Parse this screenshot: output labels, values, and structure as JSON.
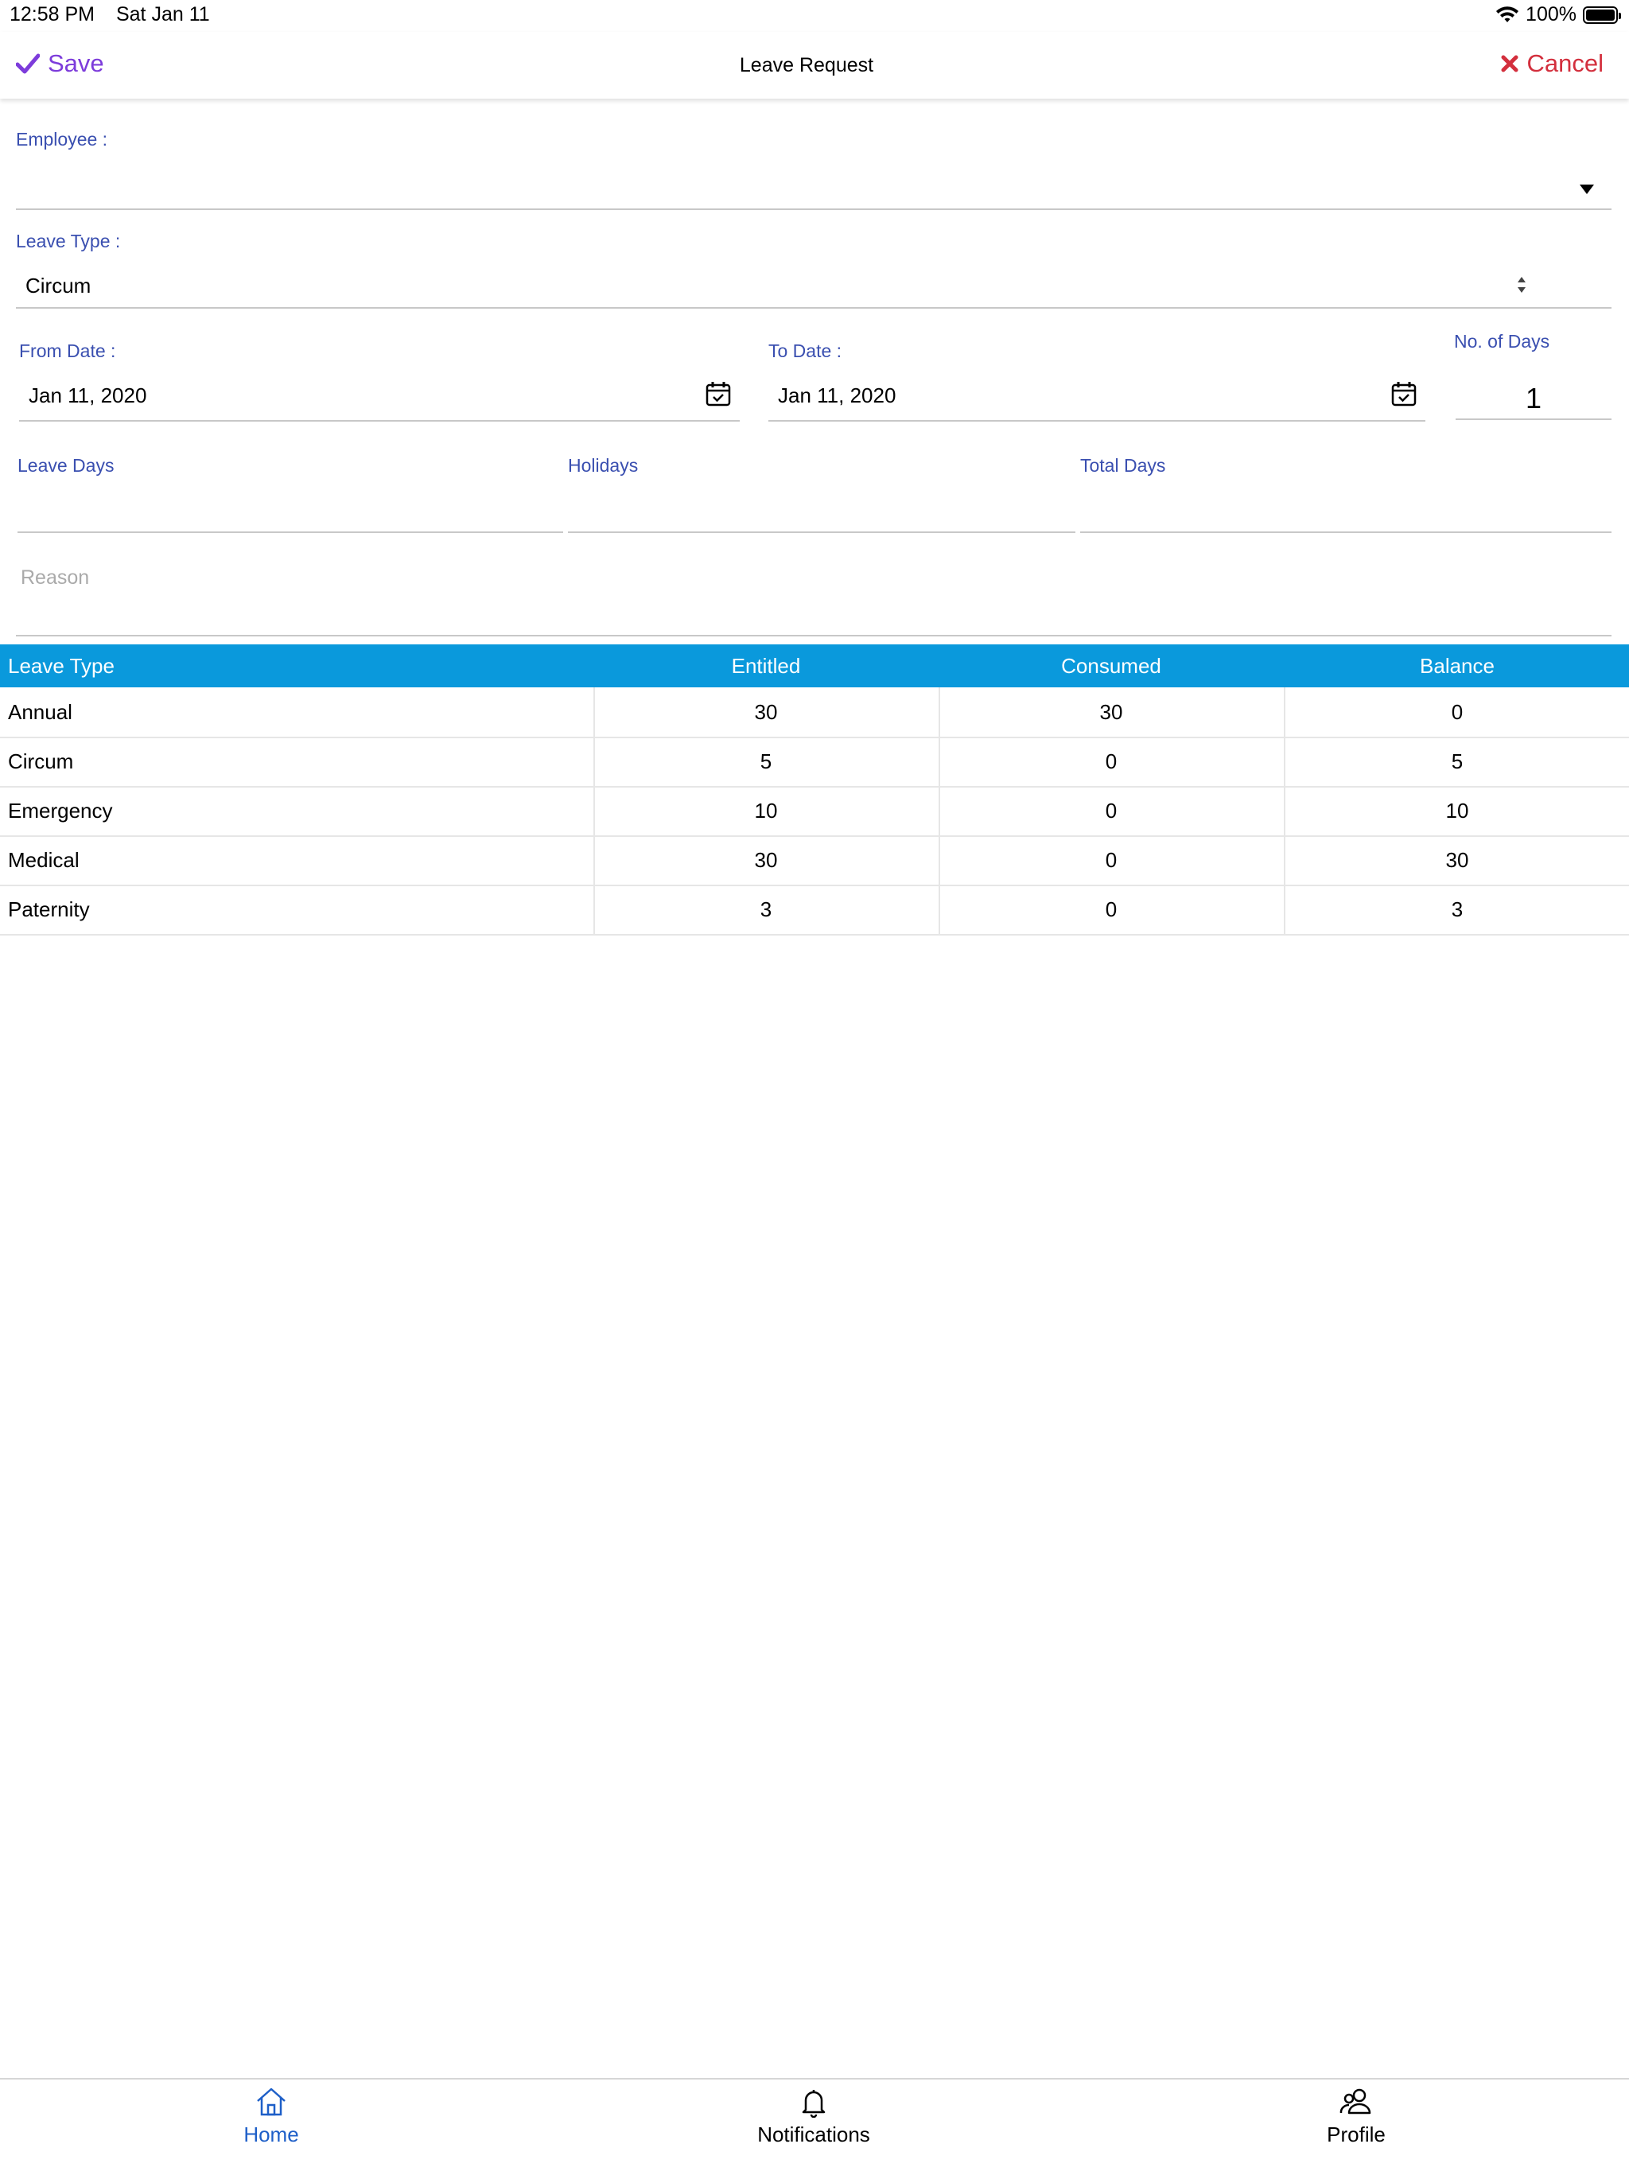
{
  "status_bar": {
    "time": "12:58 PM",
    "date": "Sat Jan 11",
    "battery": "100%",
    "wifi_icon": "wifi-icon",
    "battery_icon": "battery-icon"
  },
  "nav": {
    "save_label": "Save",
    "title": "Leave Request",
    "cancel_label": "Cancel",
    "save_color": "#7d3cdb",
    "cancel_color": "#d32f3d"
  },
  "form": {
    "employee_label": "Employee :",
    "employee_value": "",
    "leave_type_label": "Leave Type :",
    "leave_type_value": "Circum",
    "from_date_label": "From Date :",
    "from_date_value": "Jan 11, 2020",
    "to_date_label": "To Date :",
    "to_date_value": "Jan 11, 2020",
    "no_of_days_label": "No. of Days",
    "no_of_days_value": "1",
    "leave_days_label": "Leave Days",
    "holidays_label": "Holidays",
    "total_days_label": "Total Days",
    "reason_placeholder": "Reason"
  },
  "table": {
    "header_color": "#0a99dc",
    "headers": [
      "Leave Type",
      "Entitled",
      "Consumed",
      "Balance"
    ],
    "rows": [
      [
        "Annual",
        "30",
        "30",
        "0"
      ],
      [
        "Circum",
        "5",
        "0",
        "5"
      ],
      [
        "Emergency",
        "10",
        "0",
        "10"
      ],
      [
        "Medical",
        "30",
        "0",
        "30"
      ],
      [
        "Paternity",
        "3",
        "0",
        "3"
      ]
    ]
  },
  "tabs": [
    {
      "label": "Home",
      "icon": "home-icon",
      "active": true
    },
    {
      "label": "Notifications",
      "icon": "bell-icon",
      "active": false
    },
    {
      "label": "Profile",
      "icon": "users-icon",
      "active": false
    }
  ]
}
